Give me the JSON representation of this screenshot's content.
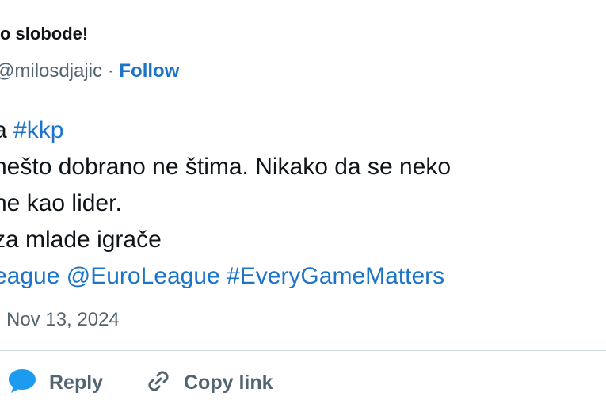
{
  "author": {
    "name_partial": "o slobode!",
    "handle_partial": "@milosdjajic",
    "separator": " · ",
    "follow_label": "Follow"
  },
  "tweet": {
    "line1_text": "a ",
    "line1_hashtag": "#kkp",
    "line2_text": " nešto dobrano ne štima. Nikako da se neko",
    "line3_text": "ne kao lider.",
    "line4_text": "za mlade igrače",
    "line5_tag1": "eague",
    "line5_tag2": "@EuroLeague",
    "line5_tag3": "#EveryGameMatters",
    "timestamp": "Nov 13, 2024"
  },
  "actions": {
    "reply_label": "Reply",
    "copy_link_label": "Copy link"
  },
  "colors": {
    "link": "#1d74c8",
    "reply_icon": "#1d9bf0",
    "muted": "#536471",
    "divider": "#cfd9de"
  },
  "icons": {
    "reply": "speech-bubble-icon",
    "copy_link": "chain-link-icon"
  }
}
